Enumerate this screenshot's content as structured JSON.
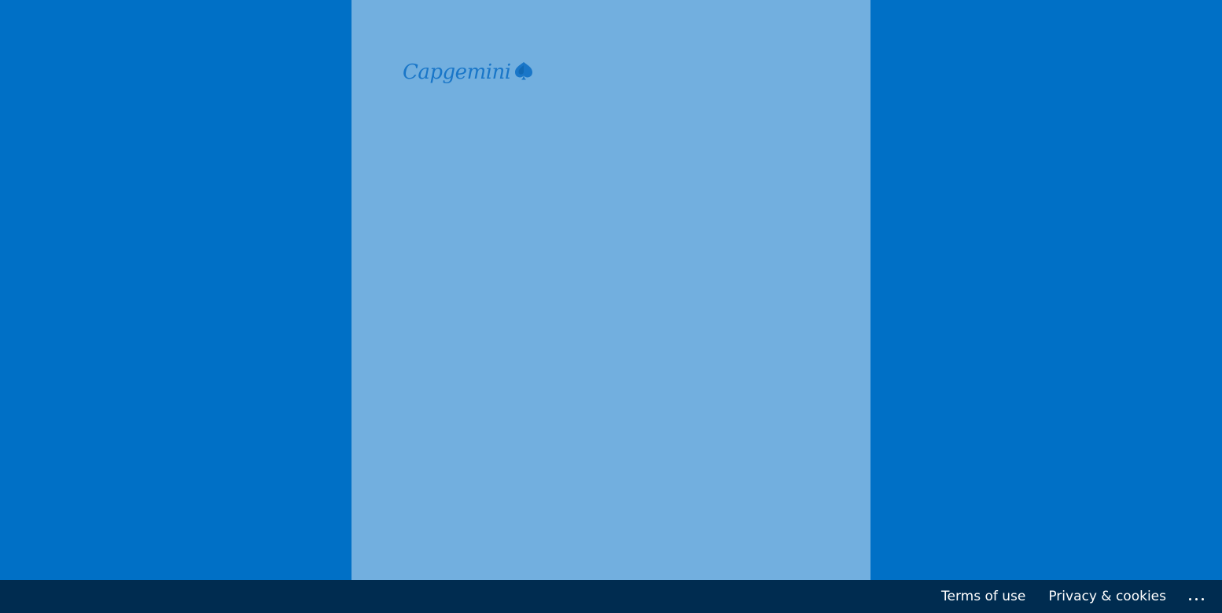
{
  "brand": {
    "logo_text": "Capgemini",
    "logo_icon": "spade-icon"
  },
  "footer": {
    "terms_label": "Terms of use",
    "privacy_label": "Privacy & cookies",
    "more_icon": "ellipsis-icon"
  },
  "colors": {
    "page_background": "#0070c6",
    "panel_background": "#72afdf",
    "logo": "#1976c8",
    "footer_background": "#002c50",
    "footer_text": "#ffffff"
  }
}
